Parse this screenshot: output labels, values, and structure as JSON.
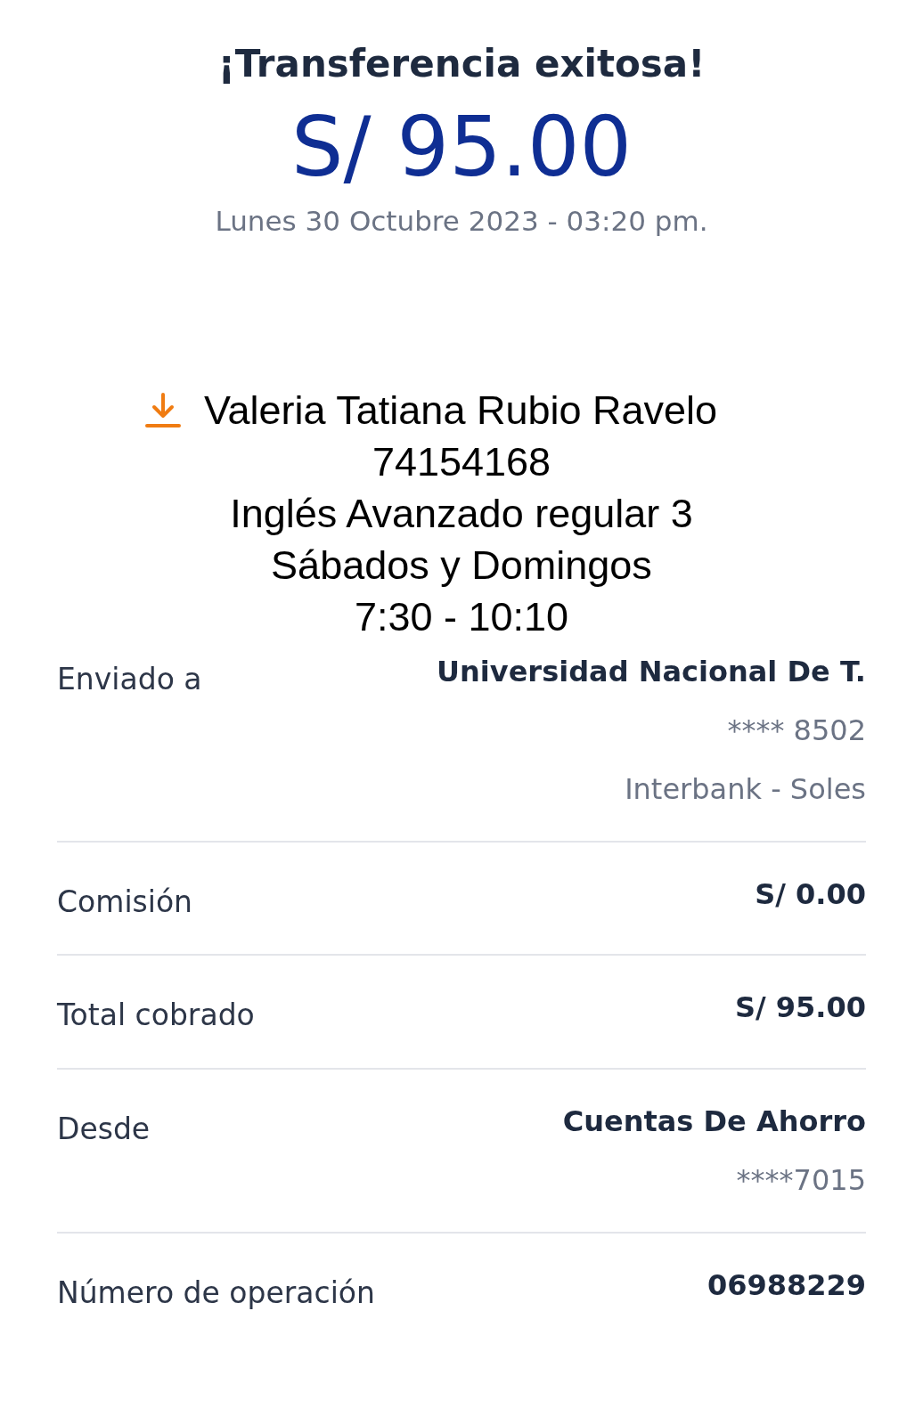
{
  "title": "¡Transferencia exitosa!",
  "amount": "S/ 95.00",
  "datetime": "Lunes 30 Octubre 2023 - 03:20 pm.",
  "note": {
    "lines": [
      "Valeria Tatiana Rubio Ravelo",
      "74154168",
      "Inglés Avanzado regular 3",
      "Sábados y Domingos",
      "7:30 - 10:10"
    ]
  },
  "details": [
    {
      "label": "Enviado a",
      "values": [
        {
          "kind": "main",
          "text": "Universidad Nacional De T."
        },
        {
          "kind": "sub",
          "text": "**** 8502"
        },
        {
          "kind": "sub",
          "text": "Interbank - Soles"
        }
      ]
    },
    {
      "label": "Comisión",
      "values": [
        {
          "kind": "main",
          "text": "S/ 0.00"
        }
      ]
    },
    {
      "label": "Total cobrado",
      "values": [
        {
          "kind": "main",
          "text": "S/ 95.00"
        }
      ]
    },
    {
      "label": "Desde",
      "values": [
        {
          "kind": "main",
          "text": "Cuentas De Ahorro"
        },
        {
          "kind": "sub",
          "text": "****7015"
        }
      ]
    },
    {
      "label": "Número de operación",
      "values": [
        {
          "kind": "main",
          "text": "06988229"
        }
      ]
    }
  ]
}
